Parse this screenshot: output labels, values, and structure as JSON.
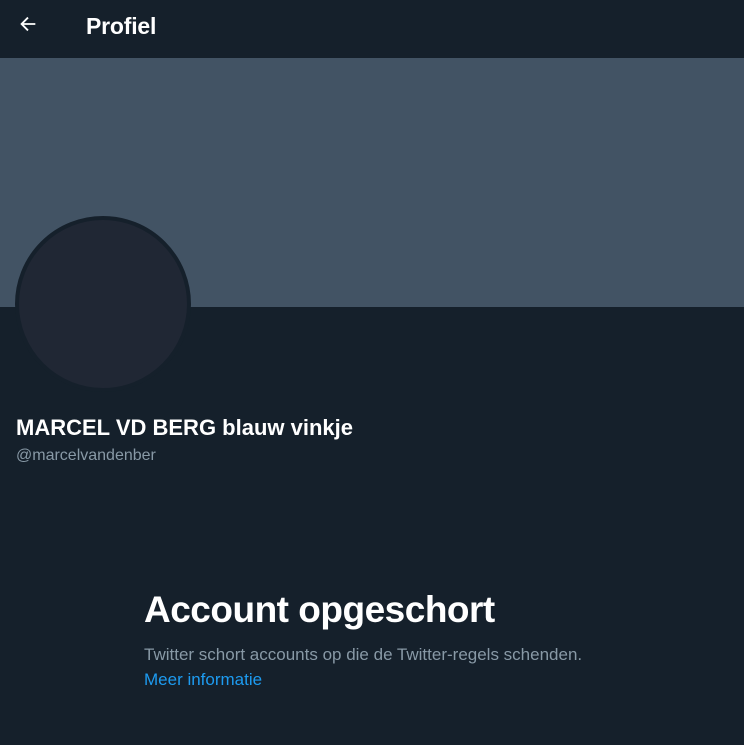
{
  "header": {
    "back_icon": "arrow-left-icon",
    "title": "Profiel"
  },
  "colors": {
    "background": "#15202b",
    "banner": "#425364",
    "avatar": "#202734",
    "secondary_text": "#8899a6",
    "link": "#1d9bf0"
  },
  "profile": {
    "display_name": "MARCEL VD BERG blauw vinkje",
    "handle": "@marcelvandenber"
  },
  "suspended": {
    "title": "Account opgeschort",
    "text": "Twitter schort accounts op die de Twitter-regels schenden.",
    "link_label": "Meer informatie"
  }
}
